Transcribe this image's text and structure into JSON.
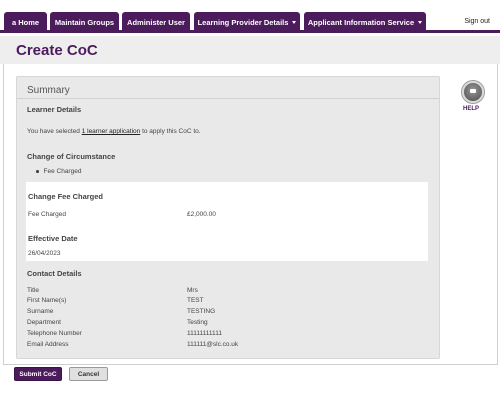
{
  "nav": {
    "tabs": [
      {
        "label": "a Home"
      },
      {
        "label": "Maintain Groups"
      },
      {
        "label": "Administer User"
      },
      {
        "label": "Learning Provider Details"
      },
      {
        "label": "Applicant Information Service"
      }
    ],
    "sign_out": "Sign out"
  },
  "page": {
    "title": "Create CoC"
  },
  "summary": {
    "title": "Summary",
    "learner_details_heading": "Learner Details",
    "selected_prefix": "You have selected",
    "selected_link": "1 learner application",
    "selected_suffix": "to apply this CoC to.",
    "coc_heading": "Change of Circumstance",
    "coc_items": [
      "Fee Charged"
    ],
    "fee_heading": "Change Fee Charged",
    "fee_label": "Fee Charged",
    "fee_value": "£2,000.00",
    "effective_heading": "Effective Date",
    "effective_value": "26/04/2023",
    "contact_heading": "Contact Details",
    "contact_rows": [
      {
        "label": "Title",
        "value": "Mrs"
      },
      {
        "label": "First Name(s)",
        "value": "TEST"
      },
      {
        "label": "Surname",
        "value": "TESTING"
      },
      {
        "label": "Department",
        "value": "Testing"
      },
      {
        "label": "Telephone Number",
        "value": "11111111111"
      },
      {
        "label": "Email Address",
        "value": "111111@slc.co.uk"
      }
    ]
  },
  "help": {
    "label": "HELP",
    "icon": "help-icon"
  },
  "actions": {
    "submit_label": "Submit CoC",
    "cancel_label": "Cancel"
  },
  "colors": {
    "brand_purple": "#4b1b5c",
    "panel_grey": "#e9e9e9"
  }
}
